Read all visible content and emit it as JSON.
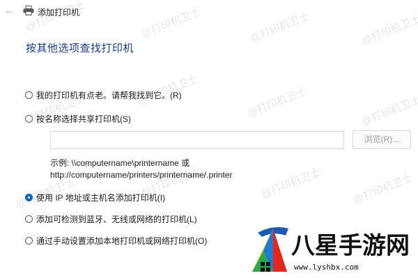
{
  "window": {
    "title": "添加打印机",
    "back_icon": "back-arrow-icon",
    "printer_icon": "printer-icon"
  },
  "heading": "按其他选项查找打印机",
  "options": [
    {
      "label": "我的打印机有点老。请帮我找到它。(R)",
      "checked": false
    },
    {
      "label": "按名称选择共享打印机(S)",
      "checked": false
    },
    {
      "label": "使用 IP 地址或主机名添加打印机(I)",
      "checked": true
    },
    {
      "label": "添加可检测到蓝牙、无线或网络的打印机(L)",
      "checked": false
    },
    {
      "label": "通过手动设置添加本地打印机或网络打印机(O)",
      "checked": false
    }
  ],
  "shared_printer_name": {
    "value": "",
    "placeholder": ""
  },
  "browse_label": "浏览(R)...",
  "example_line1": "示例: \\\\computername\\printername 或",
  "example_line2": "http://computername/printers/printername/.printer",
  "watermark_text": "@打印机卫士",
  "site_logo": {
    "name": "八星手游网",
    "url": "www.lyshbx.com"
  },
  "colors": {
    "heading": "#1f3a8f",
    "accent": "#0067c0",
    "logo_text": "#111111"
  }
}
